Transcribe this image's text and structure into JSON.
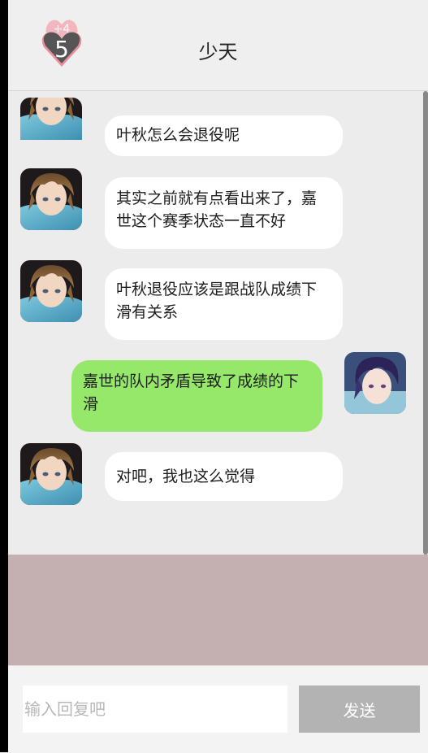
{
  "header": {
    "title": "少天",
    "badge_plus": "+4",
    "badge_count": "5"
  },
  "messages": [
    {
      "side": "in",
      "text": "叶秋怎么会退役呢"
    },
    {
      "side": "in",
      "text": "其实之前就有点看出来了，嘉世这个赛季状态一直不好"
    },
    {
      "side": "in",
      "text": "叶秋退役应该是跟战队成绩下滑有关系"
    },
    {
      "side": "out",
      "text": "嘉世的队内矛盾导致了成绩的下滑"
    },
    {
      "side": "in",
      "text": "对吧，我也这么觉得"
    }
  ],
  "footer": {
    "input_placeholder": "输入回复吧",
    "send_label": "发送"
  },
  "colors": {
    "incoming_bubble": "#ffffff",
    "outgoing_bubble": "#96e86a",
    "panel": "#c4b0b0",
    "send_button": "#b3b3b3"
  }
}
